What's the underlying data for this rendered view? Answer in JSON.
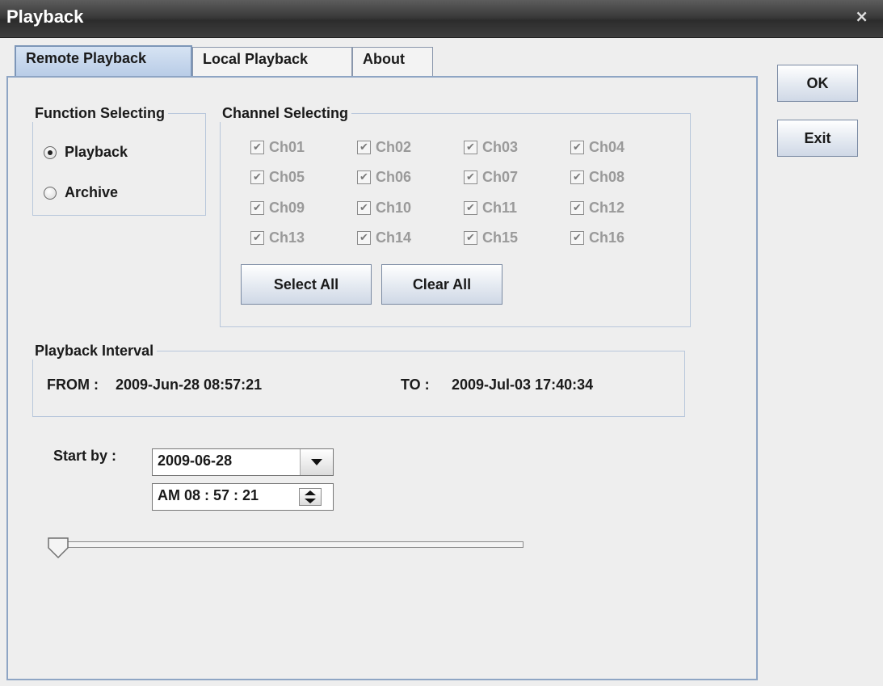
{
  "window": {
    "title": "Playback",
    "close_glyph": "×"
  },
  "tabs": [
    "Remote Playback",
    "Local Playback",
    "About"
  ],
  "buttons": {
    "ok": "OK",
    "exit": "Exit"
  },
  "function_group": {
    "legend": "Function Selecting",
    "options": [
      "Playback",
      "Archive"
    ],
    "selected": "Playback"
  },
  "channel_group": {
    "legend": "Channel Selecting",
    "channels": [
      "Ch01",
      "Ch02",
      "Ch03",
      "Ch04",
      "Ch05",
      "Ch06",
      "Ch07",
      "Ch08",
      "Ch09",
      "Ch10",
      "Ch11",
      "Ch12",
      "Ch13",
      "Ch14",
      "Ch15",
      "Ch16"
    ],
    "select_all": "Select All",
    "clear_all": "Clear All"
  },
  "interval_group": {
    "legend": "Playback Interval",
    "from_label": "FROM :",
    "from_value": "2009-Jun-28 08:57:21",
    "to_label": "TO :",
    "to_value": "2009-Jul-03 17:40:34"
  },
  "start": {
    "label": "Start by :",
    "date": "2009-06-28",
    "time": "AM 08 : 57 : 21"
  },
  "slider": {
    "position_fraction": 0.0
  }
}
